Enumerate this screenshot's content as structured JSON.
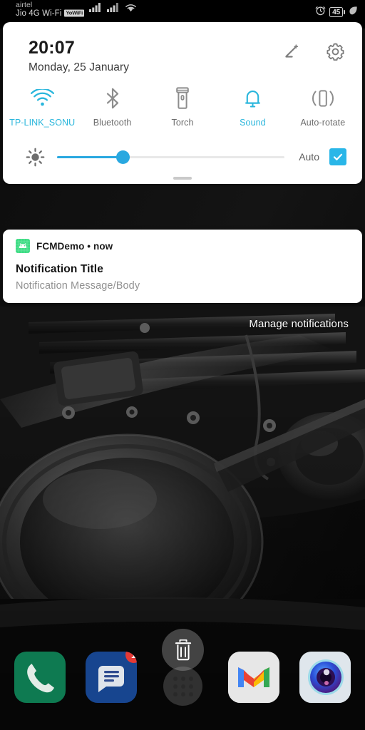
{
  "status_bar": {
    "carrier_primary": "airtel",
    "carrier_secondary": "Jio 4G Wi-Fi",
    "wifi_badge": "YoWiFi",
    "battery_level": "45",
    "icons": {
      "signal_1": "signal-bars-icon",
      "signal_2": "signal-bars-icon",
      "wifi": "wifi-icon",
      "alarm": "alarm-clock-icon",
      "battery": "battery-icon",
      "battery_saver": "leaf-icon"
    }
  },
  "quick_settings": {
    "time": "20:07",
    "date": "Monday, 25 January",
    "edit_icon": "pencil-edit-icon",
    "settings_icon": "gear-icon",
    "accent_color": "#29b6dc",
    "inactive_color": "#6d6d6d",
    "tiles": [
      {
        "label": "TP-LINK_SONU",
        "icon": "wifi-icon",
        "active": true
      },
      {
        "label": "Bluetooth",
        "icon": "bluetooth-icon",
        "active": false
      },
      {
        "label": "Torch",
        "icon": "flashlight-icon",
        "active": false
      },
      {
        "label": "Sound",
        "icon": "bell-icon",
        "active": true
      },
      {
        "label": "Auto-rotate",
        "icon": "screen-rotate-icon",
        "active": false
      }
    ],
    "brightness": {
      "icon": "brightness-sun-icon",
      "value_percent": 30,
      "auto_label": "Auto",
      "auto_checked": true,
      "check_icon": "checkmark-icon",
      "fill_color": "#29a8e0"
    },
    "drag_handle": "panel-drag-handle"
  },
  "notification": {
    "app_name": "FCMDemo",
    "separator": "•",
    "time": "now",
    "header_line": "FCMDemo • now",
    "title": "Notification Title",
    "body": "Notification Message/Body",
    "app_icon": "android-robot-icon",
    "app_icon_color": "#3ddc84"
  },
  "manage": {
    "label": "Manage notifications"
  },
  "dock": {
    "apps": [
      {
        "name": "Phone",
        "icon": "phone-handset-icon",
        "color": "#0e7a51",
        "badge": null
      },
      {
        "name": "Messages",
        "icon": "message-bubble-icon",
        "color": "#17458f",
        "badge": "1"
      },
      {
        "name": "Gmail",
        "icon": "gmail-m-icon",
        "color": "#dcdcdc",
        "badge": null
      },
      {
        "name": "Camera",
        "icon": "camera-lens-icon",
        "color": "#d4dde4",
        "badge": null
      }
    ],
    "app_drawer": "app-drawer-dots-icon",
    "trash_target": "trash-delete-icon"
  }
}
